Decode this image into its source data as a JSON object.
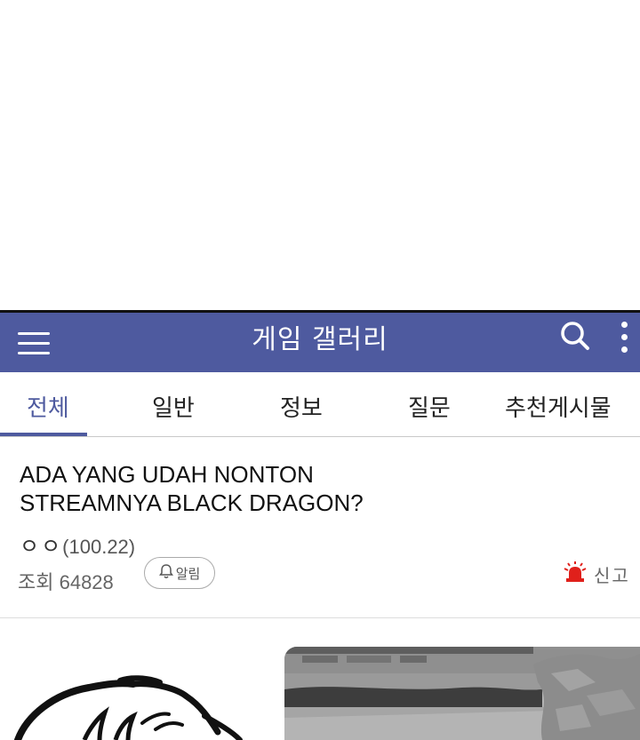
{
  "header": {
    "title": "게임 갤러리"
  },
  "tabs": [
    {
      "label": "전체",
      "active": true
    },
    {
      "label": "일반",
      "active": false
    },
    {
      "label": "정보",
      "active": false
    },
    {
      "label": "질문",
      "active": false
    },
    {
      "label": "추천게시물",
      "active": false
    }
  ],
  "post": {
    "title_line1": "ADA YANG UDAH NONTON",
    "title_line2": "STREAMNYA BLACK DRAGON?",
    "author_name": "ㅇㅇ",
    "author_ip": "(100.22)",
    "views": "조회 64828",
    "alarm_label": "알림",
    "report_label": "신고"
  },
  "colors": {
    "header_bg": "#4e5a9f",
    "accent": "#4e5a9f",
    "report_red": "#e0201b"
  },
  "icons": [
    "menu-icon",
    "search-icon",
    "more-icon",
    "bell-icon",
    "siren-icon"
  ]
}
